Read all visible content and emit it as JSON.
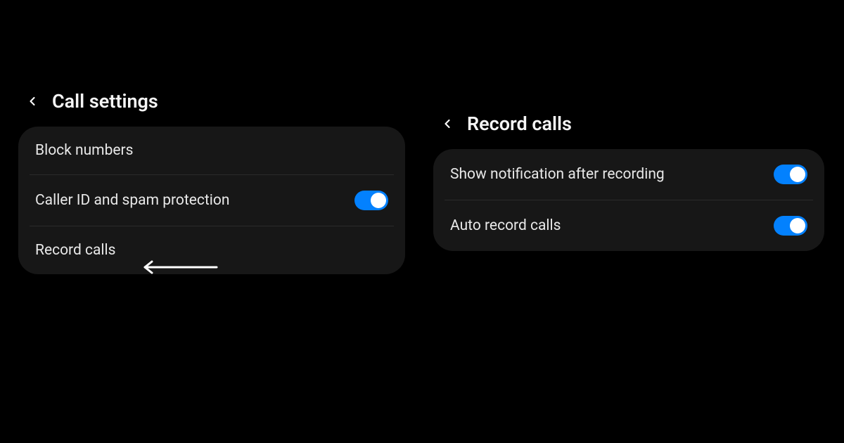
{
  "left": {
    "title": "Call settings",
    "items": [
      {
        "label": "Block numbers"
      },
      {
        "label": "Caller ID and spam protection",
        "toggle": true
      },
      {
        "label": "Record calls"
      }
    ]
  },
  "right": {
    "title": "Record calls",
    "items": [
      {
        "label": "Show notification after recording",
        "toggle": true
      },
      {
        "label": "Auto record calls",
        "toggle": true
      }
    ]
  },
  "colors": {
    "accent": "#0381fe"
  }
}
